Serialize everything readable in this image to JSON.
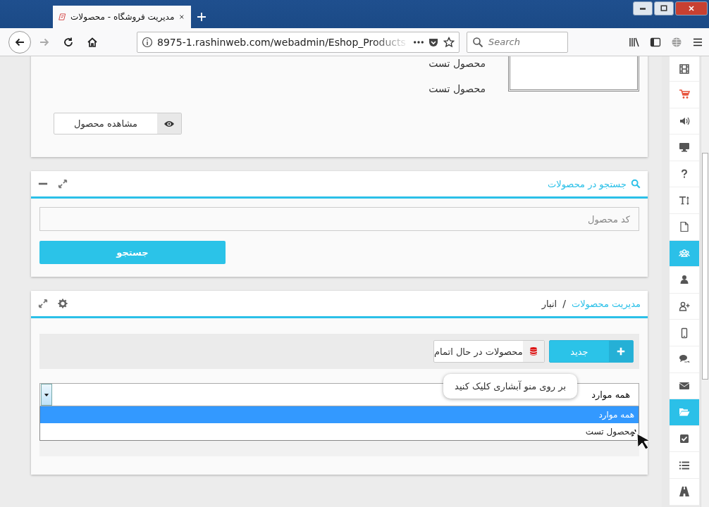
{
  "browser": {
    "tab": {
      "title": "مدیریت فروشگاه - محصولات",
      "selected": true
    },
    "nav_buttons": [
      {
        "kind": "back",
        "disabled": false
      },
      {
        "kind": "forward",
        "disabled": true
      },
      {
        "kind": "reload",
        "disabled": false
      },
      {
        "kind": "home",
        "disabled": false
      }
    ],
    "address": {
      "url": "8975-1.rashinweb.com/webadmin/Eshop_Products"
    },
    "search": {
      "placeholder": "Search"
    }
  },
  "product_card": {
    "names": [
      "محصول تست",
      "محصول تست"
    ],
    "view_button": "مشاهده محصول"
  },
  "search_panel": {
    "title": "جستجو در محصولات",
    "field": {
      "placeholder": "کد محصول"
    },
    "button": "جستجو"
  },
  "inventory_panel": {
    "breadcrumb": [
      {
        "label": "مدیریت محصولات",
        "kind": "link"
      },
      {
        "label": "انبار",
        "kind": "current"
      }
    ],
    "separator": "/",
    "toolbar": [
      {
        "label": "جدید",
        "kind": "primary"
      },
      {
        "label": "محصولات در حال اتمام",
        "kind": "secondary"
      }
    ],
    "filter": {
      "value": "همه موارد",
      "expanded": true,
      "options": [
        {
          "label": "همه موارد",
          "selected": true
        },
        {
          "label": "محصول تست",
          "selected": false
        }
      ]
    },
    "tooltip": "بر روی منو آبشاری کلیک کنید"
  },
  "sidebar": {
    "items": [
      {
        "selected": false
      },
      {
        "selected": false
      },
      {
        "selected": false
      },
      {
        "selected": false
      },
      {
        "selected": false
      },
      {
        "selected": false
      },
      {
        "selected": false
      },
      {
        "selected": true
      },
      {
        "selected": false
      },
      {
        "selected": false
      },
      {
        "selected": false
      },
      {
        "selected": false
      },
      {
        "selected": false
      },
      {
        "selected": true
      },
      {
        "selected": false
      },
      {
        "selected": false
      },
      {
        "selected": false
      }
    ]
  }
}
